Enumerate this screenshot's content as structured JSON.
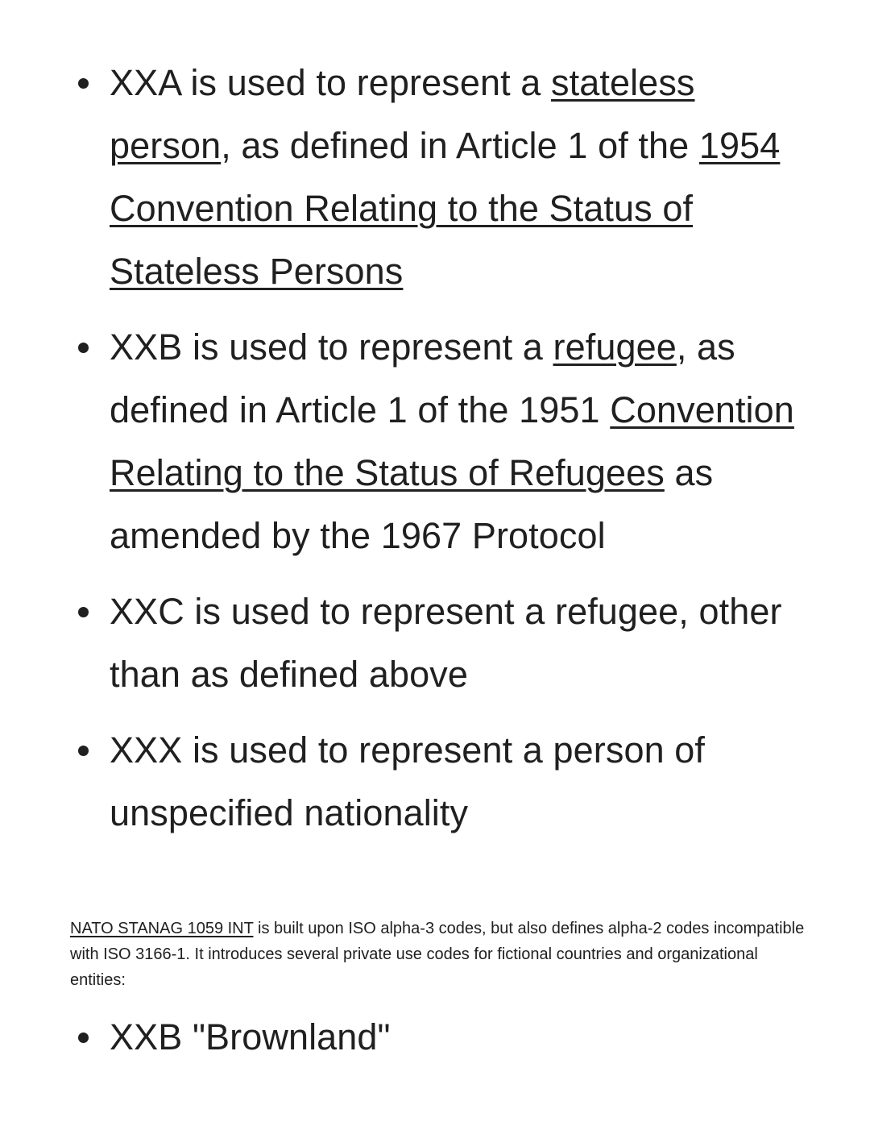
{
  "codes": [
    {
      "parts": [
        {
          "text": "XXA is used to represent a ",
          "link": false
        },
        {
          "text": "stateless person",
          "link": true
        },
        {
          "text": ", as defined in Article 1 of the ",
          "link": false
        },
        {
          "text": "1954 Convention Relating to the Status of Stateless Persons",
          "link": true
        }
      ]
    },
    {
      "parts": [
        {
          "text": "XXB is used to represent a ",
          "link": false
        },
        {
          "text": "refugee",
          "link": true
        },
        {
          "text": ", as defined in Article 1 of the 1951 ",
          "link": false
        },
        {
          "text": "Convention Relating to the Status of Refugees",
          "link": true
        },
        {
          "text": " as amended by the 1967 Protocol",
          "link": false
        }
      ]
    },
    {
      "parts": [
        {
          "text": "XXC is used to represent a refugee, other than as defined above",
          "link": false
        }
      ]
    },
    {
      "parts": [
        {
          "text": "XXX is used to represent a person of unspecified nationality",
          "link": false
        }
      ]
    }
  ],
  "nato_paragraph": {
    "link_text": "NATO STANAG 1059 INT",
    "text": " is built upon ISO alpha-3 codes, but also defines alpha-2 codes incompatible with ISO 3166-1. It introduces several private use codes for fictional countries and organizational entities:"
  },
  "fictional_codes": [
    "XXB \"Brownland\""
  ]
}
